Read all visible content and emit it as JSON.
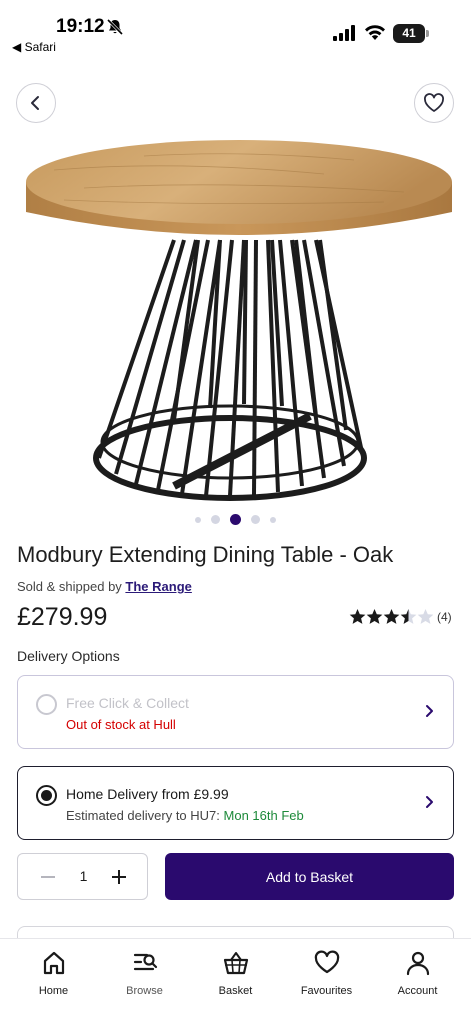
{
  "status_bar": {
    "time": "19:12",
    "back_app": "◀ Safari",
    "battery": "41"
  },
  "product": {
    "title": "Modbury Extending Dining Table - Oak",
    "sold_by_prefix": "Sold & shipped by ",
    "seller": "The Range",
    "price": "£279.99",
    "rating_value": 3.5,
    "rating_max": 5,
    "rating_count": "(4)",
    "image_count": 5,
    "active_image_index": 3
  },
  "delivery": {
    "heading": "Delivery Options",
    "click_collect": {
      "title": "Free Click & Collect",
      "status": "Out of stock at Hull"
    },
    "home_delivery": {
      "title": "Home Delivery from £9.99",
      "estimate_prefix": "Estimated delivery to HU7: ",
      "estimate_date": "Mon 16th Feb"
    }
  },
  "purchase": {
    "quantity": "1",
    "add_label": "Add to Basket"
  },
  "nav": {
    "home": "Home",
    "browse": "Browse",
    "basket": "Basket",
    "favourites": "Favourites",
    "account": "Account"
  },
  "colors": {
    "brand": "#2a0a6e",
    "out_of_stock": "#d40000",
    "delivery_date": "#1d8a3a"
  }
}
